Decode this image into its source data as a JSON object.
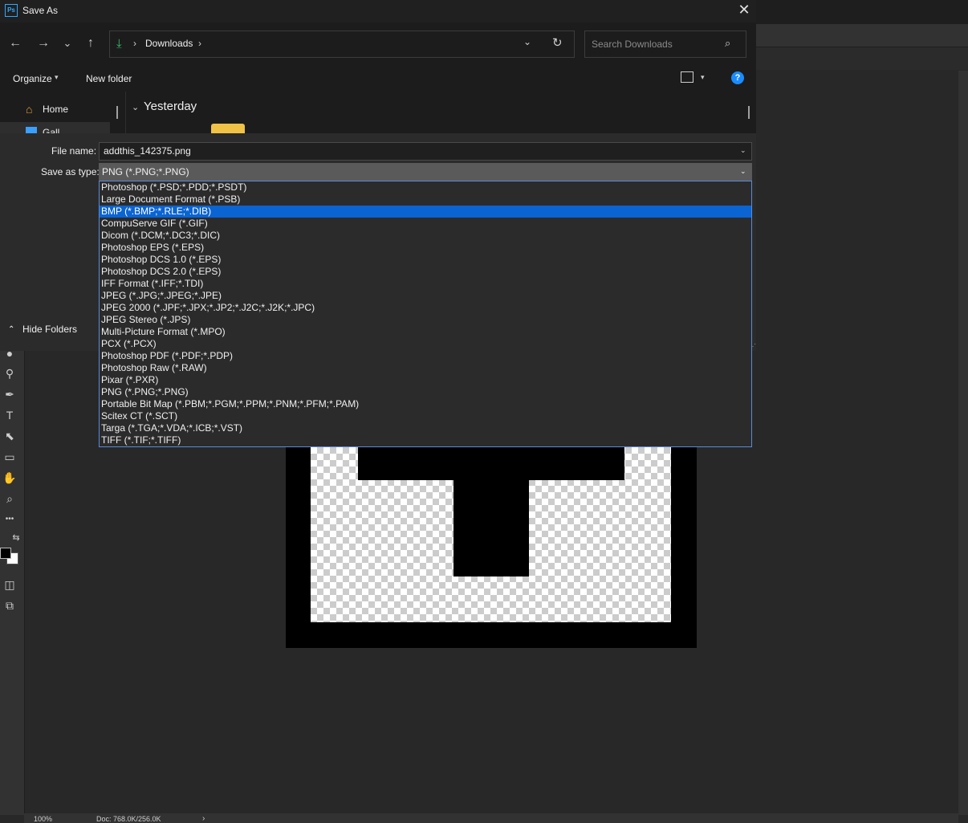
{
  "dialog": {
    "title": "Save As",
    "app_icon_text": "Ps",
    "close_glyph": "✕"
  },
  "nav": {
    "back_glyph": "←",
    "forward_glyph": "→",
    "recent_glyph": "⌄",
    "up_glyph": "↑",
    "address_location": "Downloads",
    "address_sep": "›",
    "refresh_glyph": "↻",
    "dropdown_glyph": "⌄",
    "search_placeholder": "Search Downloads",
    "search_glyph": "⌕"
  },
  "cmdbar": {
    "organize_label": "Organize",
    "organize_chevron": "▾",
    "new_folder_label": "New folder",
    "view_chevron": "▾",
    "help_glyph": "?"
  },
  "navpane": {
    "home_label": "Home",
    "home_glyph": "⌂",
    "gallery_label": "Gall"
  },
  "content": {
    "group_label": "Yesterday",
    "group_chevron": "⌄"
  },
  "form": {
    "file_name_label": "File name:",
    "file_name_value": "addthis_142375.png",
    "save_as_type_label": "Save as type:",
    "save_as_type_value": "PNG (*.PNG;*.PNG)",
    "chevron": "⌄",
    "hide_folders_label": "Hide Folders",
    "hide_folders_chevron": "⌃"
  },
  "type_options": [
    {
      "label": "Photoshop (*.PSD;*.PDD;*.PSDT)",
      "selected": false
    },
    {
      "label": "Large Document Format (*.PSB)",
      "selected": false
    },
    {
      "label": "BMP (*.BMP;*.RLE;*.DIB)",
      "selected": true
    },
    {
      "label": "CompuServe GIF (*.GIF)",
      "selected": false
    },
    {
      "label": "Dicom (*.DCM;*.DC3;*.DIC)",
      "selected": false
    },
    {
      "label": "Photoshop EPS (*.EPS)",
      "selected": false
    },
    {
      "label": "Photoshop DCS 1.0 (*.EPS)",
      "selected": false
    },
    {
      "label": "Photoshop DCS 2.0 (*.EPS)",
      "selected": false
    },
    {
      "label": "IFF Format (*.IFF;*.TDI)",
      "selected": false
    },
    {
      "label": "JPEG (*.JPG;*.JPEG;*.JPE)",
      "selected": false
    },
    {
      "label": "JPEG 2000 (*.JPF;*.JPX;*.JP2;*.J2C;*.J2K;*.JPC)",
      "selected": false
    },
    {
      "label": "JPEG Stereo (*.JPS)",
      "selected": false
    },
    {
      "label": "Multi-Picture Format (*.MPO)",
      "selected": false
    },
    {
      "label": "PCX (*.PCX)",
      "selected": false
    },
    {
      "label": "Photoshop PDF (*.PDF;*.PDP)",
      "selected": false
    },
    {
      "label": "Photoshop Raw (*.RAW)",
      "selected": false
    },
    {
      "label": "Pixar (*.PXR)",
      "selected": false
    },
    {
      "label": "PNG (*.PNG;*.PNG)",
      "selected": false
    },
    {
      "label": "Portable Bit Map (*.PBM;*.PGM;*.PPM;*.PNM;*.PFM;*.PAM)",
      "selected": false
    },
    {
      "label": "Scitex CT (*.SCT)",
      "selected": false
    },
    {
      "label": "Targa (*.TGA;*.VDA;*.ICB;*.VST)",
      "selected": false
    },
    {
      "label": "TIFF (*.TIF;*.TIFF)",
      "selected": false
    }
  ],
  "statusbar": {
    "zoom": "100%",
    "doc_info": "Doc: 768.0K/256.0K",
    "chevron": "›"
  },
  "tools": [
    {
      "name": "spot-healing-icon",
      "glyph": "●"
    },
    {
      "name": "dodge-icon",
      "glyph": "⚲"
    },
    {
      "name": "pen-icon",
      "glyph": "✒"
    },
    {
      "name": "type-icon",
      "glyph": "T"
    },
    {
      "name": "path-selection-icon",
      "glyph": "⬉"
    },
    {
      "name": "rectangle-icon",
      "glyph": "▭"
    },
    {
      "name": "hand-icon",
      "glyph": "✋"
    },
    {
      "name": "zoom-icon",
      "glyph": "⌕"
    },
    {
      "name": "more-tools-icon",
      "glyph": "•••"
    },
    {
      "name": "swap-colors-icon",
      "glyph": "⇆"
    },
    {
      "name": "quick-mask-icon",
      "glyph": "◫"
    },
    {
      "name": "screen-mode-icon",
      "glyph": "⧉"
    }
  ],
  "colors": {
    "accent": "#0a64d2",
    "help_blue": "#1a8cff",
    "download_green": "#3fba6b"
  }
}
